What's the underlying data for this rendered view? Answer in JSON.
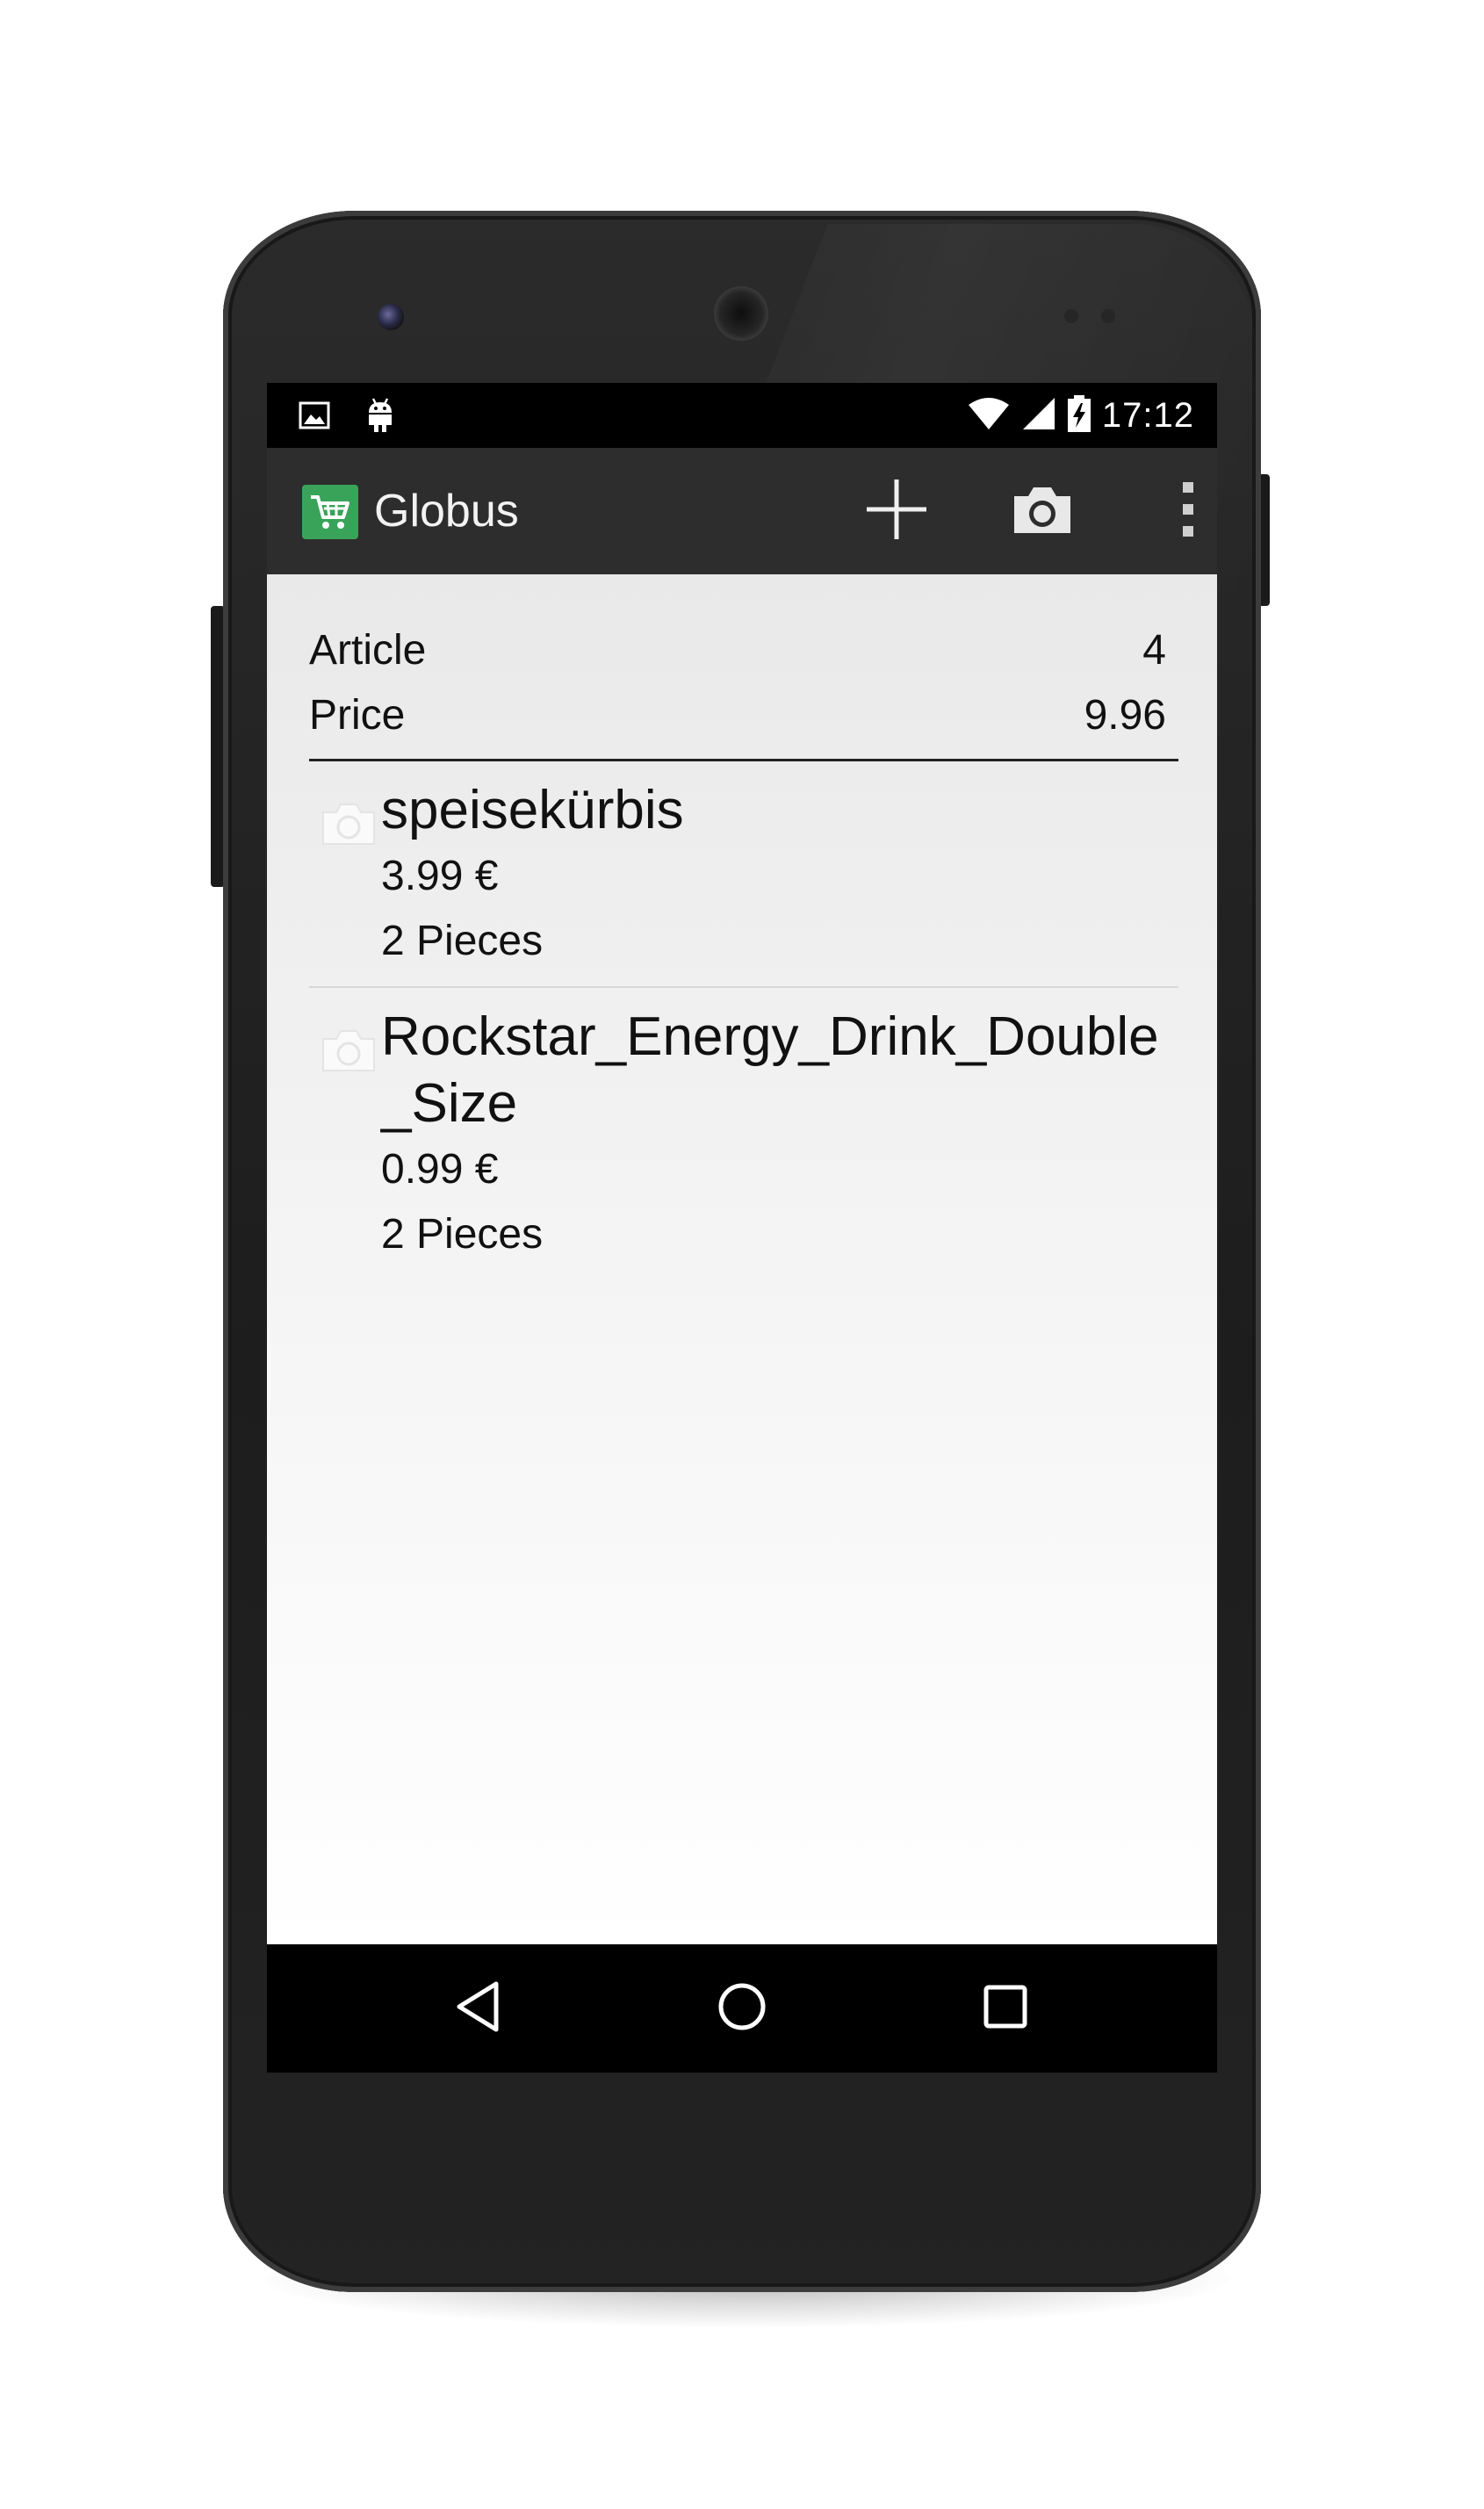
{
  "status_bar": {
    "time": "17:12",
    "icons": [
      "image-notification-icon",
      "android-debug-icon",
      "wifi-icon",
      "cell-signal-icon",
      "battery-charging-icon"
    ]
  },
  "action_bar": {
    "title": "Globus",
    "logo_icon": "shopping-cart-icon",
    "actions": [
      "add-icon",
      "camera-icon",
      "overflow-menu-icon"
    ]
  },
  "summary": {
    "article_label": "Article",
    "article_value": "4",
    "price_label": "Price",
    "price_value": "9.96"
  },
  "items": [
    {
      "name": "speisekürbis",
      "price": "3.99 €",
      "quantity": "2 Pieces"
    },
    {
      "name": "Rockstar_Energy_Drink_Double_Size",
      "price": "0.99 €",
      "quantity": "2 Pieces"
    }
  ],
  "nav_bar": {
    "buttons": [
      "back-icon",
      "home-icon",
      "recents-icon"
    ]
  },
  "colors": {
    "accent": "#3aa35a",
    "action_bar": "#2d2d2d",
    "content_bg": "#efefef",
    "phone_body": "#222222"
  }
}
